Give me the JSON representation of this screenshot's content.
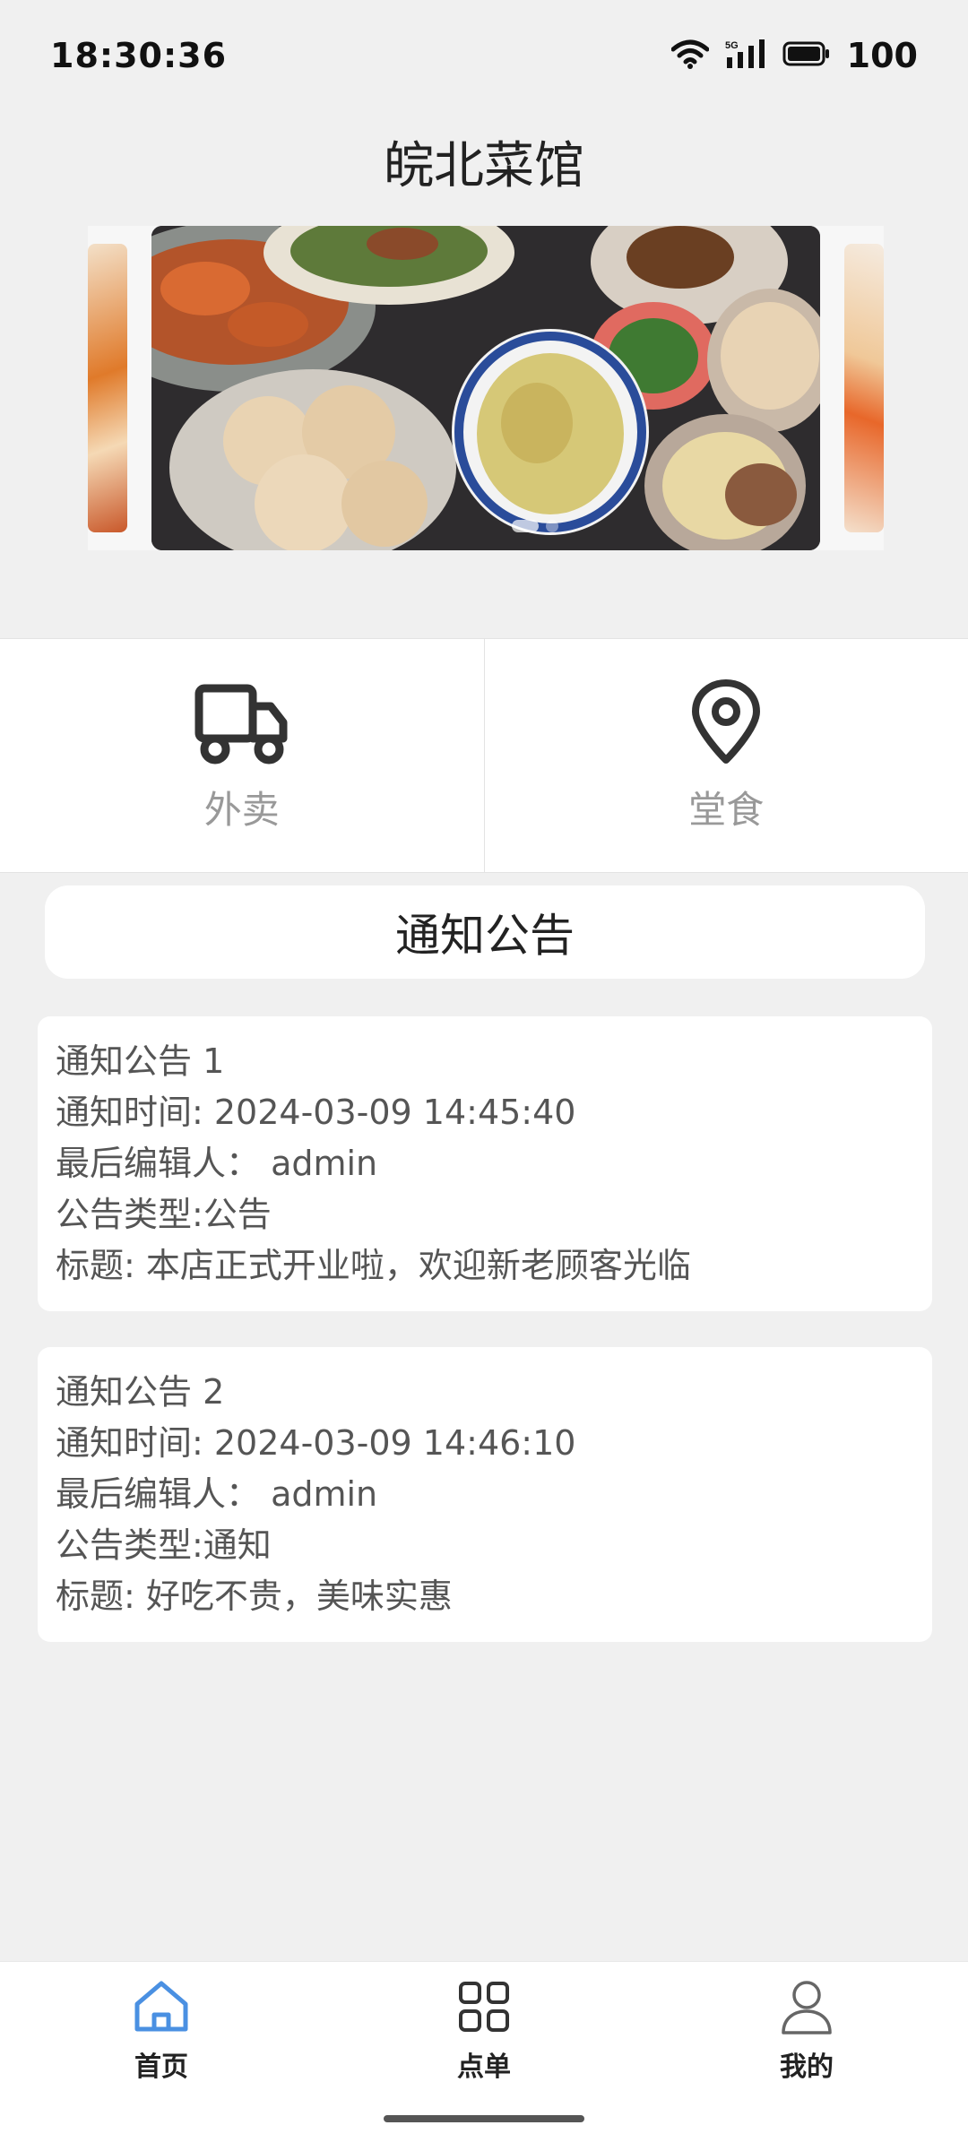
{
  "status_bar": {
    "time": "18:30:36",
    "battery": "100",
    "network": "5G",
    "icons": [
      "wifi-icon",
      "signal-icon",
      "battery-icon"
    ]
  },
  "page": {
    "title": "皖北菜馆"
  },
  "banner": {
    "slide_count": 2,
    "active_index": 0
  },
  "services": [
    {
      "label": "外卖",
      "icon": "truck-icon"
    },
    {
      "label": "堂食",
      "icon": "location-pin-icon"
    }
  ],
  "notice_section": {
    "title": "通知公告"
  },
  "notices": [
    {
      "heading": "通知公告 1",
      "time": "通知时间: 2024-03-09 14:45:40",
      "editor": "最后编辑人：  admin",
      "type": "公告类型:公告",
      "title": "标题: 本店正式开业啦，欢迎新老顾客光临"
    },
    {
      "heading": "通知公告 2",
      "time": "通知时间: 2024-03-09 14:46:10",
      "editor": "最后编辑人：  admin",
      "type": "公告类型:通知",
      "title": "标题: 好吃不贵，美味实惠"
    }
  ],
  "nav": [
    {
      "label": "首页",
      "icon": "home-icon",
      "active": true
    },
    {
      "label": "点单",
      "icon": "grid-icon",
      "active": false
    },
    {
      "label": "我的",
      "icon": "user-icon",
      "active": false
    }
  ],
  "colors": {
    "accent": "#4a90e2",
    "background": "#f0f0f0"
  }
}
